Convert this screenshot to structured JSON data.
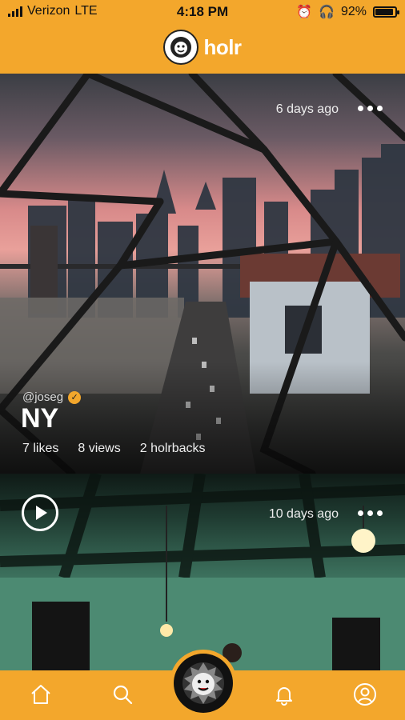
{
  "status_bar": {
    "carrier": "Verizon",
    "network": "LTE",
    "time": "4:18 PM",
    "battery": "92%",
    "battery_level": 0.92
  },
  "header": {
    "app_name": "holr",
    "logo_icon": "lion-logo-icon"
  },
  "feed": [
    {
      "time_ago": "6 days ago",
      "username": "@joseg",
      "title": "NY",
      "likes": "7 likes",
      "views": "8 views",
      "holrbacks": "2 holrbacks"
    },
    {
      "time_ago": "10 days ago"
    }
  ],
  "tabbar": {
    "items": [
      "home-icon",
      "search-icon",
      "lion-logo-icon",
      "bell-icon",
      "profile-icon"
    ]
  },
  "colors": {
    "accent": "#f3a72c",
    "text_light": "#ffffff"
  }
}
